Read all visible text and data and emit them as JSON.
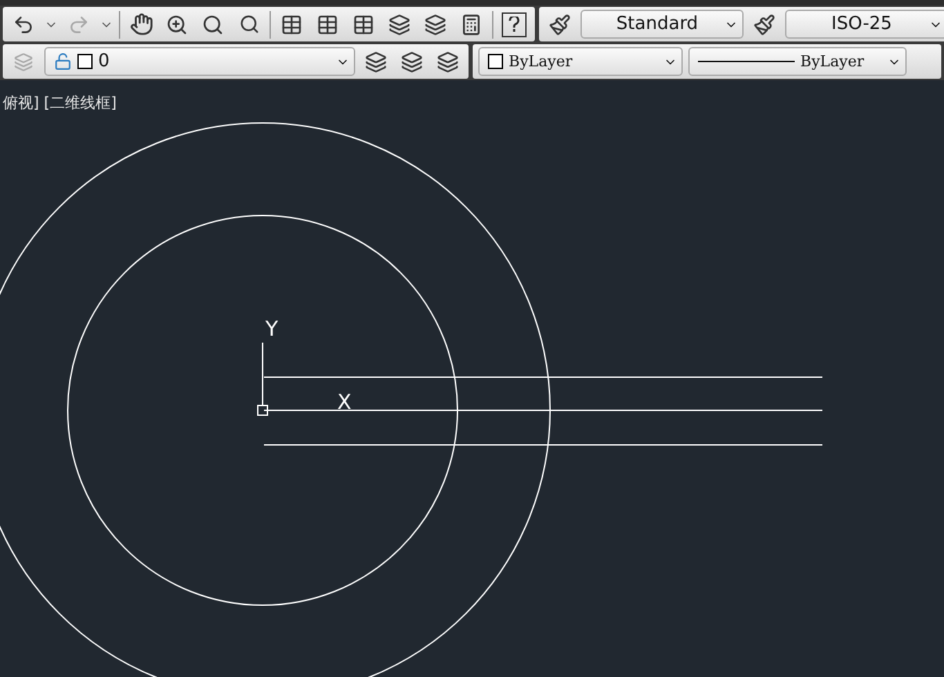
{
  "standard_toolbar": {
    "redo": {
      "disabled": true
    },
    "text_style": {
      "value": "Standard"
    },
    "dim_style": {
      "value": "ISO-25"
    }
  },
  "layers_toolbar": {
    "layer": {
      "value": "0"
    },
    "color": {
      "value": "ByLayer"
    },
    "linetype": {
      "value": "ByLayer"
    }
  },
  "viewport": {
    "label": "俯视] [二维线框]",
    "ucs": {
      "y_label": "Y",
      "x_label": "X"
    }
  }
}
